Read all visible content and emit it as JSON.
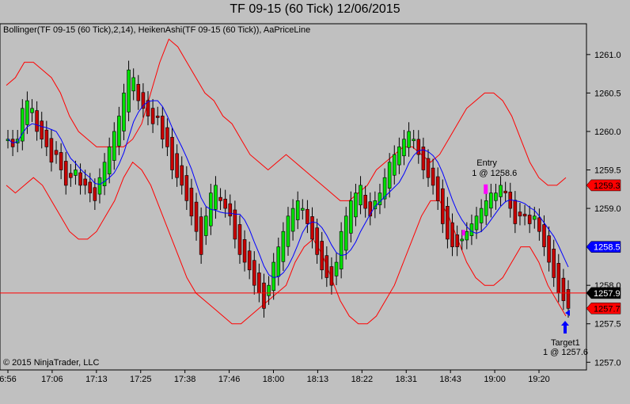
{
  "header": {
    "title": "TF 09-15 (60 Tick)  12/06/2015",
    "indicators": "Bollinger(TF 09-15 (60 Tick),2,14), HeikenAshi(TF 09-15 (60 Tick)), AaPriceLine",
    "copyright": "© 2015 NinjaTrader, LLC"
  },
  "colors": {
    "background": "#c0c0c0",
    "up_candle": "#00e000",
    "down_candle": "#c80000",
    "bollinger": "#ff0000",
    "middle_band": "#0000ff",
    "price_line": "#ff0000",
    "arrow": "#0000ff",
    "entry_marker": "#ff00ff"
  },
  "chart_data": {
    "type": "candlestick",
    "instrument": "TF 09-15",
    "bar_type": "60 Tick",
    "date": "12/06/2015",
    "ylim": [
      1256.9,
      1261.4
    ],
    "y_ticks": [
      1257.0,
      1257.5,
      1258.0,
      1258.5,
      1259.0,
      1259.5,
      1260.0,
      1260.5,
      1261.0
    ],
    "x_ticks": [
      "6:56",
      "17:06",
      "17:13",
      "17:25",
      "17:38",
      "17:46",
      "18:00",
      "18:13",
      "18:22",
      "18:31",
      "18:43",
      "19:00",
      "19:20"
    ],
    "price_line": 1257.9,
    "badges": [
      {
        "label": "1259.3",
        "value": 1259.3,
        "style": "red"
      },
      {
        "label": "1258.5",
        "value": 1258.5,
        "style": "blue"
      },
      {
        "label": "1257.9",
        "value": 1257.9,
        "style": "black"
      },
      {
        "label": "1257.7",
        "value": 1257.7,
        "style": "red"
      }
    ],
    "closes": [
      1259.9,
      1259.8,
      1259.9,
      1260.3,
      1260.4,
      1260.3,
      1260.0,
      1259.9,
      1259.8,
      1259.6,
      1259.7,
      1259.5,
      1259.3,
      1259.4,
      1259.5,
      1259.3,
      1259.3,
      1259.2,
      1259.1,
      1259.4,
      1259.6,
      1259.8,
      1260.0,
      1260.2,
      1260.5,
      1260.8,
      1260.7,
      1260.4,
      1260.3,
      1260.2,
      1260.1,
      1260.2,
      1259.9,
      1259.8,
      1259.5,
      1259.4,
      1259.3,
      1259.1,
      1258.9,
      1258.7,
      1258.4,
      1258.9,
      1259.2,
      1259.3,
      1259.1,
      1259.0,
      1258.9,
      1258.6,
      1258.4,
      1258.3,
      1258.2,
      1258.0,
      1257.9,
      1257.7,
      1258.0,
      1258.3,
      1258.5,
      1258.7,
      1258.9,
      1259.0,
      1259.1,
      1259.0,
      1258.8,
      1258.6,
      1258.4,
      1258.2,
      1258.1,
      1258.0,
      1258.3,
      1258.7,
      1258.9,
      1259.1,
      1259.2,
      1259.3,
      1259.0,
      1258.9,
      1259.1,
      1259.2,
      1259.4,
      1259.6,
      1259.7,
      1259.8,
      1259.9,
      1260.0,
      1259.9,
      1259.7,
      1259.5,
      1259.4,
      1259.3,
      1259.1,
      1258.8,
      1258.6,
      1258.5,
      1258.5,
      1258.6,
      1258.7,
      1258.8,
      1258.9,
      1259.0,
      1259.1,
      1259.2,
      1259.2,
      1259.3,
      1259.2,
      1259.0,
      1258.8,
      1258.9,
      1258.9,
      1258.8,
      1258.9,
      1258.7,
      1258.5,
      1258.3,
      1258.1,
      1257.9,
      1257.8,
      1257.7
    ],
    "upper_band": [
      1260.6,
      1260.7,
      1260.9,
      1260.9,
      1260.8,
      1260.7,
      1260.5,
      1260.2,
      1260.0,
      1259.9,
      1259.8,
      1259.8,
      1259.8,
      1259.8,
      1259.9,
      1260.1,
      1260.5,
      1260.9,
      1261.2,
      1261.1,
      1260.9,
      1260.7,
      1260.5,
      1260.4,
      1260.2,
      1260.1,
      1259.9,
      1259.7,
      1259.6,
      1259.5,
      1259.6,
      1259.7,
      1259.6,
      1259.5,
      1259.4,
      1259.3,
      1259.2,
      1259.1,
      1259.1,
      1259.2,
      1259.3,
      1259.5,
      1259.6,
      1259.7,
      1259.8,
      1259.8,
      1259.7,
      1259.6,
      1259.7,
      1259.9,
      1260.1,
      1260.3,
      1260.4,
      1260.5,
      1260.5,
      1260.4,
      1260.2,
      1259.9,
      1259.6,
      1259.4,
      1259.3,
      1259.3,
      1259.4
    ],
    "lower_band": [
      1259.3,
      1259.2,
      1259.3,
      1259.4,
      1259.3,
      1259.1,
      1258.9,
      1258.7,
      1258.6,
      1258.6,
      1258.7,
      1258.9,
      1259.1,
      1259.4,
      1259.6,
      1259.5,
      1259.3,
      1259.0,
      1258.7,
      1258.4,
      1258.1,
      1257.9,
      1257.8,
      1257.7,
      1257.6,
      1257.5,
      1257.5,
      1257.6,
      1257.7,
      1257.8,
      1257.9,
      1258.0,
      1258.3,
      1258.5,
      1258.6,
      1258.4,
      1258.1,
      1257.8,
      1257.6,
      1257.5,
      1257.5,
      1257.6,
      1257.8,
      1258.0,
      1258.3,
      1258.6,
      1258.9,
      1259.1,
      1259.1,
      1258.9,
      1258.6,
      1258.3,
      1258.1,
      1258.0,
      1258.0,
      1258.1,
      1258.3,
      1258.5,
      1258.5,
      1258.3,
      1258.0,
      1257.8,
      1257.6
    ],
    "annotations": [
      {
        "label": "Entry",
        "value": "1 @ 1258.6",
        "type": "entry",
        "price": 1259.25
      },
      {
        "label": "Target1",
        "value": "1 @ 1257.6",
        "type": "target",
        "price": 1257.6
      }
    ],
    "legend": "none",
    "grid": false
  }
}
